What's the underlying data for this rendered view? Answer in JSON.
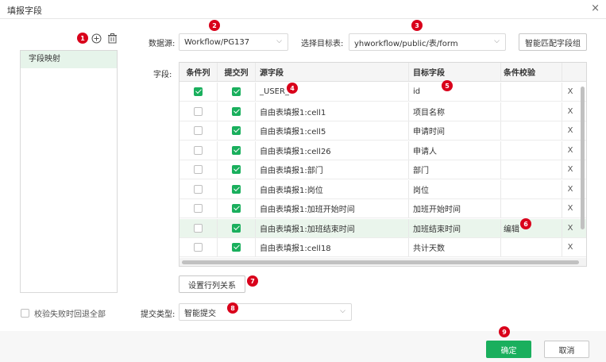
{
  "dialog": {
    "title": "填报字段",
    "close_glyph": "×"
  },
  "markers": [
    "1",
    "2",
    "3",
    "4",
    "5",
    "6",
    "7",
    "8",
    "9"
  ],
  "left_panel": {
    "items": [
      {
        "label": "字段映射"
      }
    ]
  },
  "toolbar": {
    "datasource_label": "数据源:",
    "datasource_value": "Workflow/PG137",
    "target_table_label": "选择目标表:",
    "target_table_value": "yhworkflow/public/表/form",
    "smart_match_button": "智能匹配字段组"
  },
  "fields_label": "字段:",
  "grid": {
    "headers": [
      "条件列",
      "提交列",
      "源字段",
      "目标字段",
      "条件校验",
      ""
    ],
    "rows": [
      {
        "condition": true,
        "submit": true,
        "source": "_USER_",
        "target": "id",
        "check": "",
        "remove": "X"
      },
      {
        "condition": false,
        "submit": true,
        "source": "自由表填报1:cell1",
        "target": "项目名称",
        "check": "",
        "remove": "X"
      },
      {
        "condition": false,
        "submit": true,
        "source": "自由表填报1:cell5",
        "target": "申请时间",
        "check": "",
        "remove": "X"
      },
      {
        "condition": false,
        "submit": true,
        "source": "自由表填报1:cell26",
        "target": "申请人",
        "check": "",
        "remove": "X"
      },
      {
        "condition": false,
        "submit": true,
        "source": "自由表填报1:部门",
        "target": "部门",
        "check": "",
        "remove": "X"
      },
      {
        "condition": false,
        "submit": true,
        "source": "自由表填报1:岗位",
        "target": "岗位",
        "check": "",
        "remove": "X"
      },
      {
        "condition": false,
        "submit": true,
        "source": "自由表填报1:加班开始时间",
        "target": "加班开始时间",
        "check": "",
        "remove": "X"
      },
      {
        "condition": false,
        "submit": true,
        "source": "自由表填报1:加班结束时间",
        "target": "加班结束时间",
        "check": "编辑",
        "remove": "X"
      },
      {
        "condition": false,
        "submit": true,
        "source": "自由表填报1:cell18",
        "target": "共计天数",
        "check": "",
        "remove": "X"
      }
    ]
  },
  "set_row_col_button": "设置行列关系",
  "rollback_label": "校验失败时回退全部",
  "submit_type": {
    "label": "提交类型:",
    "value": "智能提交"
  },
  "footer": {
    "ok": "确定",
    "cancel": "取消"
  },
  "colors": {
    "accent": "#1aaf5d",
    "marker": "#d9001b",
    "selected_row": "#eaf5ec"
  }
}
